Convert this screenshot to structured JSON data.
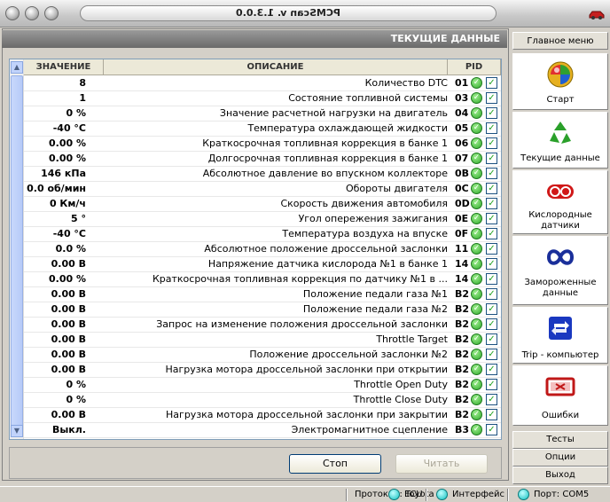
{
  "window": {
    "title": "PCMScan v. 1.3.0.0"
  },
  "section": {
    "title": "ТЕКУЩИЕ ДАННЫЕ"
  },
  "table": {
    "headers": {
      "pid": "PID",
      "desc": "ОПИСАНИЕ",
      "value": "ЗНАЧЕНИЕ"
    },
    "rows": [
      {
        "pid": "01",
        "desc": "Количество DTC",
        "value": "8"
      },
      {
        "pid": "03",
        "desc": "Состояние топливной системы",
        "value": "1"
      },
      {
        "pid": "04",
        "desc": "Значение расчетной нагрузки на двигатель",
        "value": "0 %"
      },
      {
        "pid": "05",
        "desc": "Температура охлаждающей жидкости",
        "value": "-40 °C"
      },
      {
        "pid": "06",
        "desc": "Краткосрочная топливная коррекция в банке 1",
        "value": "0.00 %"
      },
      {
        "pid": "07",
        "desc": "Долгосрочная топливная коррекция в банке 1",
        "value": "0.00 %"
      },
      {
        "pid": "0B",
        "desc": "Абсолютное давление во впускном коллекторе",
        "value": "146 кПа"
      },
      {
        "pid": "0C",
        "desc": "Обороты двигателя",
        "value": "0.0 об/мин"
      },
      {
        "pid": "0D",
        "desc": "Скорость движения автомобиля",
        "value": "0 Км/ч"
      },
      {
        "pid": "0E",
        "desc": "Угол опережения зажигания",
        "value": "5 °"
      },
      {
        "pid": "0F",
        "desc": "Температура воздуха на впуске",
        "value": "-40 °C"
      },
      {
        "pid": "11",
        "desc": "Абсолютное положение дроссельной заслонки",
        "value": "0.0 %"
      },
      {
        "pid": "14",
        "desc": "Напряжение датчика кислорода №1 в банке 1",
        "value": "0.00 B"
      },
      {
        "pid": "14",
        "desc": "Краткосрочная топливная коррекция по датчику №1 в ...",
        "value": "0.00 %"
      },
      {
        "pid": "B2",
        "desc": "Положение педали газа №1",
        "value": "0.00 B"
      },
      {
        "pid": "B2",
        "desc": "Положение педали газа №2",
        "value": "0.00 B"
      },
      {
        "pid": "B2",
        "desc": "Запрос на изменение положения дроссельной заслонки",
        "value": "0.00 B"
      },
      {
        "pid": "B2",
        "desc": "Throttle Target",
        "value": "0.00 B"
      },
      {
        "pid": "B2",
        "desc": "Положение дроссельной заслонки №2",
        "value": "0.00 B"
      },
      {
        "pid": "B2",
        "desc": "Нагрузка мотора дроссельной заслонки при открытии",
        "value": "0.00 B"
      },
      {
        "pid": "B2",
        "desc": "Throttle Open Duty",
        "value": "0 %"
      },
      {
        "pid": "B2",
        "desc": "Throttle Close Duty",
        "value": "0 %"
      },
      {
        "pid": "B2",
        "desc": "Нагрузка мотора дроссельной заслонки при закрытии",
        "value": "0.00 B"
      },
      {
        "pid": "B3",
        "desc": "Электромагнитное сцепление",
        "value": "Выкл."
      }
    ]
  },
  "buttons": {
    "stop": "Стоп",
    "read": "Читать"
  },
  "sidebar": {
    "menu_label": "Главное меню",
    "items": [
      {
        "label": "Старт",
        "icon": "start-icon"
      },
      {
        "label": "Текущие данные",
        "icon": "recycle-icon"
      },
      {
        "label": "Кислородные датчики",
        "icon": "oxygen-sensor-icon"
      },
      {
        "label": "Замороженные данные",
        "icon": "freeze-frame-icon"
      },
      {
        "label": "Trip - компьютер",
        "icon": "trip-computer-icon"
      },
      {
        "label": "Ошибки",
        "icon": "errors-icon"
      }
    ],
    "bottom": [
      {
        "label": "Тесты"
      },
      {
        "label": "Опции"
      },
      {
        "label": "Выход"
      }
    ]
  },
  "status": {
    "port": "Порт: COM5",
    "interface": "Интерфейс",
    "ecu": "ECU",
    "protocol": "Протокол: Toyota"
  }
}
